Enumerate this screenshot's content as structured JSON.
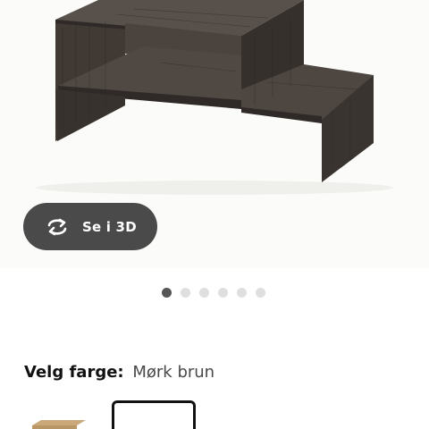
{
  "gallery": {
    "view_3d_label": "Se i 3D",
    "pagination": {
      "total": 6,
      "active_index": 0
    }
  },
  "color_selector": {
    "label": "Velg farge:",
    "selected_value": "Mørk brun",
    "options": [
      {
        "name": "oak",
        "color": "#c9a97a",
        "selected": false
      },
      {
        "name": "dark-brown",
        "color": "#3f3935",
        "selected": true
      }
    ]
  },
  "colors": {
    "wood_dark": "#3f3935",
    "wood_edge": "#2f2a27",
    "button_bg": "#4a4a4a",
    "dot_active": "#555555",
    "dot_inactive": "#dfdfdf"
  }
}
